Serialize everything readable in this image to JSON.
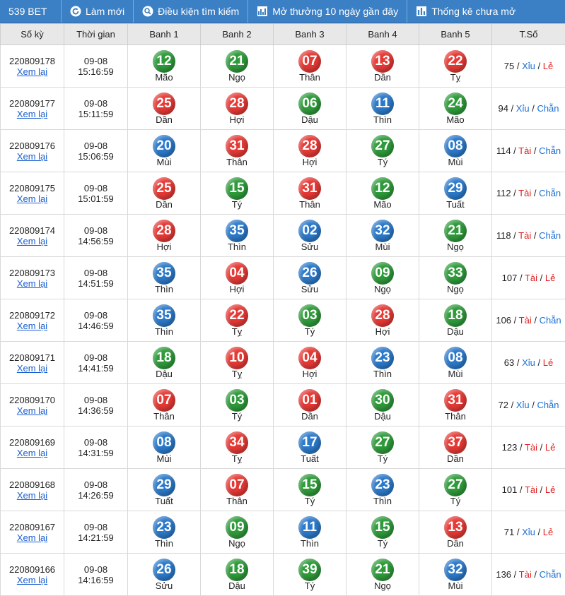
{
  "toolbar": {
    "brand": "539 BET",
    "refresh": "Làm mới",
    "search": "Điều kiện tìm kiếm",
    "recent": "Mở thưởng 10 ngày gần đây",
    "stats": "Thống kê chưa mở"
  },
  "headers": [
    "Số kỳ",
    "Thời gian",
    "Banh 1",
    "Banh 2",
    "Banh 3",
    "Banh 4",
    "Banh 5",
    "T.Số"
  ],
  "colors": {
    "red": "#e53935",
    "green": "#2e9a3a",
    "blue": "#2b79c9",
    "header_bg": "#3b7fc4"
  },
  "rows": [
    {
      "ky": "220809178",
      "link": "Xem lại",
      "date": "09-08",
      "time": "15:16:59",
      "balls": [
        {
          "n": "12",
          "z": "Mão",
          "c": "green"
        },
        {
          "n": "21",
          "z": "Ngọ",
          "c": "green"
        },
        {
          "n": "07",
          "z": "Thân",
          "c": "red"
        },
        {
          "n": "13",
          "z": "Dần",
          "c": "red"
        },
        {
          "n": "22",
          "z": "Tỵ",
          "c": "red"
        }
      ],
      "sum": "75",
      "size": "Xỉu",
      "size_c": "blue",
      "parity": "Lẻ",
      "parity_c": "red"
    },
    {
      "ky": "220809177",
      "link": "Xem lại",
      "date": "09-08",
      "time": "15:11:59",
      "balls": [
        {
          "n": "25",
          "z": "Dần",
          "c": "red"
        },
        {
          "n": "28",
          "z": "Hợi",
          "c": "red"
        },
        {
          "n": "06",
          "z": "Dậu",
          "c": "green"
        },
        {
          "n": "11",
          "z": "Thìn",
          "c": "blue"
        },
        {
          "n": "24",
          "z": "Mão",
          "c": "green"
        }
      ],
      "sum": "94",
      "size": "Xỉu",
      "size_c": "blue",
      "parity": "Chẵn",
      "parity_c": "blue"
    },
    {
      "ky": "220809176",
      "link": "Xem lại",
      "date": "09-08",
      "time": "15:06:59",
      "balls": [
        {
          "n": "20",
          "z": "Mùi",
          "c": "blue"
        },
        {
          "n": "31",
          "z": "Thân",
          "c": "red"
        },
        {
          "n": "28",
          "z": "Hợi",
          "c": "red"
        },
        {
          "n": "27",
          "z": "Tý",
          "c": "green"
        },
        {
          "n": "08",
          "z": "Mùi",
          "c": "blue"
        }
      ],
      "sum": "114",
      "size": "Tài",
      "size_c": "red",
      "parity": "Chẵn",
      "parity_c": "blue"
    },
    {
      "ky": "220809175",
      "link": "Xem lại",
      "date": "09-08",
      "time": "15:01:59",
      "balls": [
        {
          "n": "25",
          "z": "Dần",
          "c": "red"
        },
        {
          "n": "15",
          "z": "Tý",
          "c": "green"
        },
        {
          "n": "31",
          "z": "Thân",
          "c": "red"
        },
        {
          "n": "12",
          "z": "Mão",
          "c": "green"
        },
        {
          "n": "29",
          "z": "Tuất",
          "c": "blue"
        }
      ],
      "sum": "112",
      "size": "Tài",
      "size_c": "red",
      "parity": "Chẵn",
      "parity_c": "blue"
    },
    {
      "ky": "220809174",
      "link": "Xem lại",
      "date": "09-08",
      "time": "14:56:59",
      "balls": [
        {
          "n": "28",
          "z": "Hợi",
          "c": "red"
        },
        {
          "n": "35",
          "z": "Thìn",
          "c": "blue"
        },
        {
          "n": "02",
          "z": "Sửu",
          "c": "blue"
        },
        {
          "n": "32",
          "z": "Mùi",
          "c": "blue"
        },
        {
          "n": "21",
          "z": "Ngọ",
          "c": "green"
        }
      ],
      "sum": "118",
      "size": "Tài",
      "size_c": "red",
      "parity": "Chẵn",
      "parity_c": "blue"
    },
    {
      "ky": "220809173",
      "link": "Xem lại",
      "date": "09-08",
      "time": "14:51:59",
      "balls": [
        {
          "n": "35",
          "z": "Thìn",
          "c": "blue"
        },
        {
          "n": "04",
          "z": "Hợi",
          "c": "red"
        },
        {
          "n": "26",
          "z": "Sửu",
          "c": "blue"
        },
        {
          "n": "09",
          "z": "Ngọ",
          "c": "green"
        },
        {
          "n": "33",
          "z": "Ngọ",
          "c": "green"
        }
      ],
      "sum": "107",
      "size": "Tài",
      "size_c": "red",
      "parity": "Lẻ",
      "parity_c": "red"
    },
    {
      "ky": "220809172",
      "link": "Xem lại",
      "date": "09-08",
      "time": "14:46:59",
      "balls": [
        {
          "n": "35",
          "z": "Thìn",
          "c": "blue"
        },
        {
          "n": "22",
          "z": "Tỵ",
          "c": "red"
        },
        {
          "n": "03",
          "z": "Tý",
          "c": "green"
        },
        {
          "n": "28",
          "z": "Hợi",
          "c": "red"
        },
        {
          "n": "18",
          "z": "Dậu",
          "c": "green"
        }
      ],
      "sum": "106",
      "size": "Tài",
      "size_c": "red",
      "parity": "Chẵn",
      "parity_c": "blue"
    },
    {
      "ky": "220809171",
      "link": "Xem lại",
      "date": "09-08",
      "time": "14:41:59",
      "balls": [
        {
          "n": "18",
          "z": "Dậu",
          "c": "green"
        },
        {
          "n": "10",
          "z": "Tỵ",
          "c": "red"
        },
        {
          "n": "04",
          "z": "Hợi",
          "c": "red"
        },
        {
          "n": "23",
          "z": "Thìn",
          "c": "blue"
        },
        {
          "n": "08",
          "z": "Mùi",
          "c": "blue"
        }
      ],
      "sum": "63",
      "size": "Xỉu",
      "size_c": "blue",
      "parity": "Lẻ",
      "parity_c": "red"
    },
    {
      "ky": "220809170",
      "link": "Xem lại",
      "date": "09-08",
      "time": "14:36:59",
      "balls": [
        {
          "n": "07",
          "z": "Thân",
          "c": "red"
        },
        {
          "n": "03",
          "z": "Tý",
          "c": "green"
        },
        {
          "n": "01",
          "z": "Dần",
          "c": "red"
        },
        {
          "n": "30",
          "z": "Dậu",
          "c": "green"
        },
        {
          "n": "31",
          "z": "Thân",
          "c": "red"
        }
      ],
      "sum": "72",
      "size": "Xỉu",
      "size_c": "blue",
      "parity": "Chẵn",
      "parity_c": "blue"
    },
    {
      "ky": "220809169",
      "link": "Xem lại",
      "date": "09-08",
      "time": "14:31:59",
      "balls": [
        {
          "n": "08",
          "z": "Mùi",
          "c": "blue"
        },
        {
          "n": "34",
          "z": "Tỵ",
          "c": "red"
        },
        {
          "n": "17",
          "z": "Tuất",
          "c": "blue"
        },
        {
          "n": "27",
          "z": "Tý",
          "c": "green"
        },
        {
          "n": "37",
          "z": "Dần",
          "c": "red"
        }
      ],
      "sum": "123",
      "size": "Tài",
      "size_c": "red",
      "parity": "Lẻ",
      "parity_c": "red"
    },
    {
      "ky": "220809168",
      "link": "Xem lại",
      "date": "09-08",
      "time": "14:26:59",
      "balls": [
        {
          "n": "29",
          "z": "Tuất",
          "c": "blue"
        },
        {
          "n": "07",
          "z": "Thân",
          "c": "red"
        },
        {
          "n": "15",
          "z": "Tý",
          "c": "green"
        },
        {
          "n": "23",
          "z": "Thìn",
          "c": "blue"
        },
        {
          "n": "27",
          "z": "Tý",
          "c": "green"
        }
      ],
      "sum": "101",
      "size": "Tài",
      "size_c": "red",
      "parity": "Lẻ",
      "parity_c": "red"
    },
    {
      "ky": "220809167",
      "link": "Xem lại",
      "date": "09-08",
      "time": "14:21:59",
      "balls": [
        {
          "n": "23",
          "z": "Thìn",
          "c": "blue"
        },
        {
          "n": "09",
          "z": "Ngọ",
          "c": "green"
        },
        {
          "n": "11",
          "z": "Thìn",
          "c": "blue"
        },
        {
          "n": "15",
          "z": "Tý",
          "c": "green"
        },
        {
          "n": "13",
          "z": "Dần",
          "c": "red"
        }
      ],
      "sum": "71",
      "size": "Xỉu",
      "size_c": "blue",
      "parity": "Lẻ",
      "parity_c": "red"
    },
    {
      "ky": "220809166",
      "link": "Xem lại",
      "date": "09-08",
      "time": "14:16:59",
      "balls": [
        {
          "n": "26",
          "z": "Sửu",
          "c": "blue"
        },
        {
          "n": "18",
          "z": "Dậu",
          "c": "green"
        },
        {
          "n": "39",
          "z": "Tý",
          "c": "green"
        },
        {
          "n": "21",
          "z": "Ngọ",
          "c": "green"
        },
        {
          "n": "32",
          "z": "Mùi",
          "c": "blue"
        }
      ],
      "sum": "136",
      "size": "Tài",
      "size_c": "red",
      "parity": "Chẵn",
      "parity_c": "blue"
    }
  ]
}
